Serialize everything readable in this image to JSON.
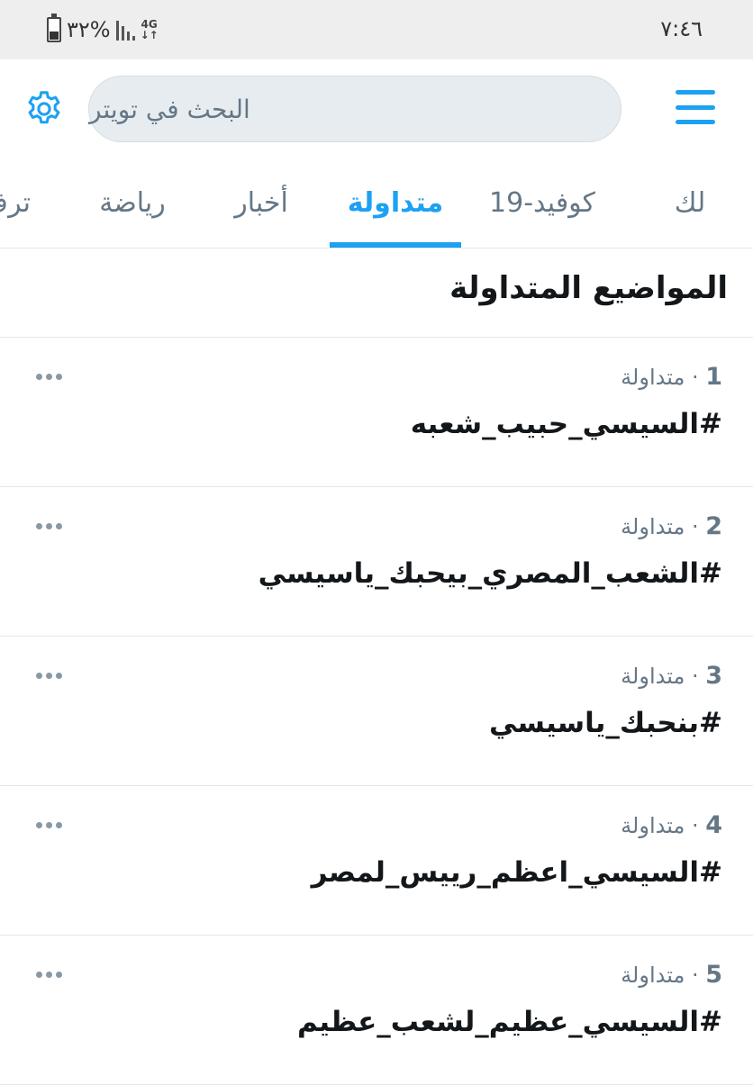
{
  "status_bar": {
    "time": "٧:٤٦",
    "battery": "٣٢%",
    "network": "4G"
  },
  "header": {
    "search_placeholder": "البحث في تويتر",
    "menu_icon": "hamburger-icon",
    "settings_icon": "gear-icon"
  },
  "tabs": [
    {
      "label": "لك",
      "active": false
    },
    {
      "label": "كوفيد-19",
      "active": false
    },
    {
      "label": "متداولة",
      "active": true
    },
    {
      "label": "أخبار",
      "active": false
    },
    {
      "label": "رياضة",
      "active": false
    },
    {
      "label": "ترف",
      "active": false
    }
  ],
  "section_title": "المواضيع المتداولة",
  "trends": [
    {
      "rank": "1",
      "category": "متداولة",
      "name": "#السيسي_حبيب_شعبه"
    },
    {
      "rank": "2",
      "category": "متداولة",
      "name": "#الشعب_المصري_بيحبك_ياسيسي"
    },
    {
      "rank": "3",
      "category": "متداولة",
      "name": "#بنحبك_ياسيسي"
    },
    {
      "rank": "4",
      "category": "متداولة",
      "name": "#السيسي_اعظم_رييس_لمصر"
    },
    {
      "rank": "5",
      "category": "متداولة",
      "name": "#السيسي_عظيم_لشعب_عظيم"
    }
  ],
  "colors": {
    "accent": "#1da1f2",
    "secondary_text": "#657786",
    "primary_text": "#14171a",
    "search_bg": "#e6ecf0"
  }
}
